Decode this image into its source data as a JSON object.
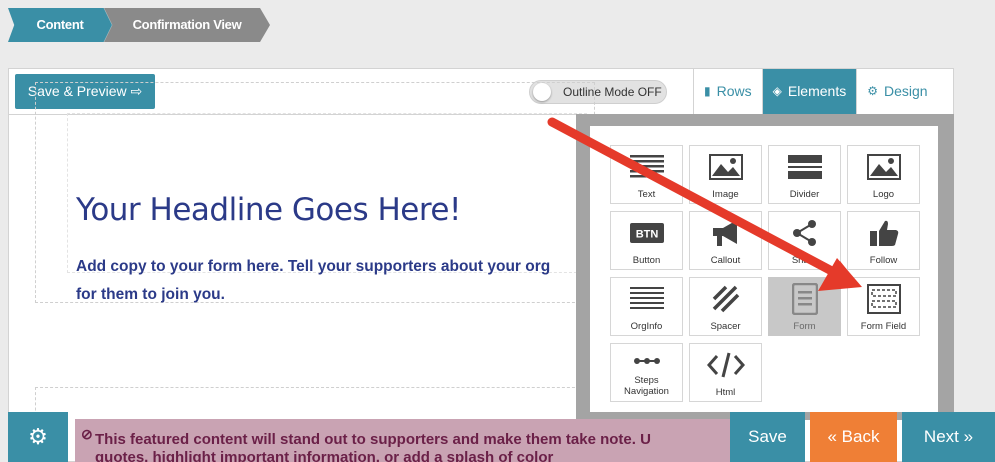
{
  "breadcrumb": {
    "steps": [
      "Content",
      "Confirmation View"
    ]
  },
  "toolbar": {
    "save_preview_label": "Save & Preview",
    "outline_mode_label": "Outline Mode OFF",
    "tabs": [
      {
        "label": "Rows",
        "icon": "rows-icon"
      },
      {
        "label": "Elements",
        "icon": "layers-icon",
        "active": true
      },
      {
        "label": "Design",
        "icon": "palette-icon"
      }
    ]
  },
  "canvas": {
    "headline": "Your Headline Goes Here!",
    "copy_line1": "Add copy to your form here. Tell your supporters about your org",
    "copy_line2": "for them to join you.",
    "featured_line1": "This featured content will stand out to supporters and make them take note. U",
    "featured_line2": "quotes, highlight important information, or add a splash of color"
  },
  "elements": [
    {
      "label": "Text",
      "icon": "text-icon"
    },
    {
      "label": "Image",
      "icon": "image-icon"
    },
    {
      "label": "Divider",
      "icon": "divider-icon"
    },
    {
      "label": "Logo",
      "icon": "logo-image-icon"
    },
    {
      "label": "Button",
      "icon": "btn-icon",
      "glyph": "BTN"
    },
    {
      "label": "Callout",
      "icon": "megaphone-icon"
    },
    {
      "label": "Share",
      "icon": "share-icon"
    },
    {
      "label": "Follow",
      "icon": "thumbs-up-icon"
    },
    {
      "label": "OrgInfo",
      "icon": "org-info-icon"
    },
    {
      "label": "Spacer",
      "icon": "spacer-icon"
    },
    {
      "label": "Form",
      "icon": "form-icon",
      "disabled": true
    },
    {
      "label": "Form Field",
      "icon": "form-field-icon"
    },
    {
      "label": "Steps\nNavigation",
      "icon": "steps-navigation-icon"
    },
    {
      "label": "Html",
      "icon": "code-icon"
    }
  ],
  "footer": {
    "save_label": "Save",
    "back_label": "« Back",
    "next_label": "Next »"
  },
  "colors": {
    "primary": "#3a8fa6",
    "back_button": "#ef7f36",
    "headline": "#2b3a88",
    "annotation_arrow": "#e53a2a"
  }
}
